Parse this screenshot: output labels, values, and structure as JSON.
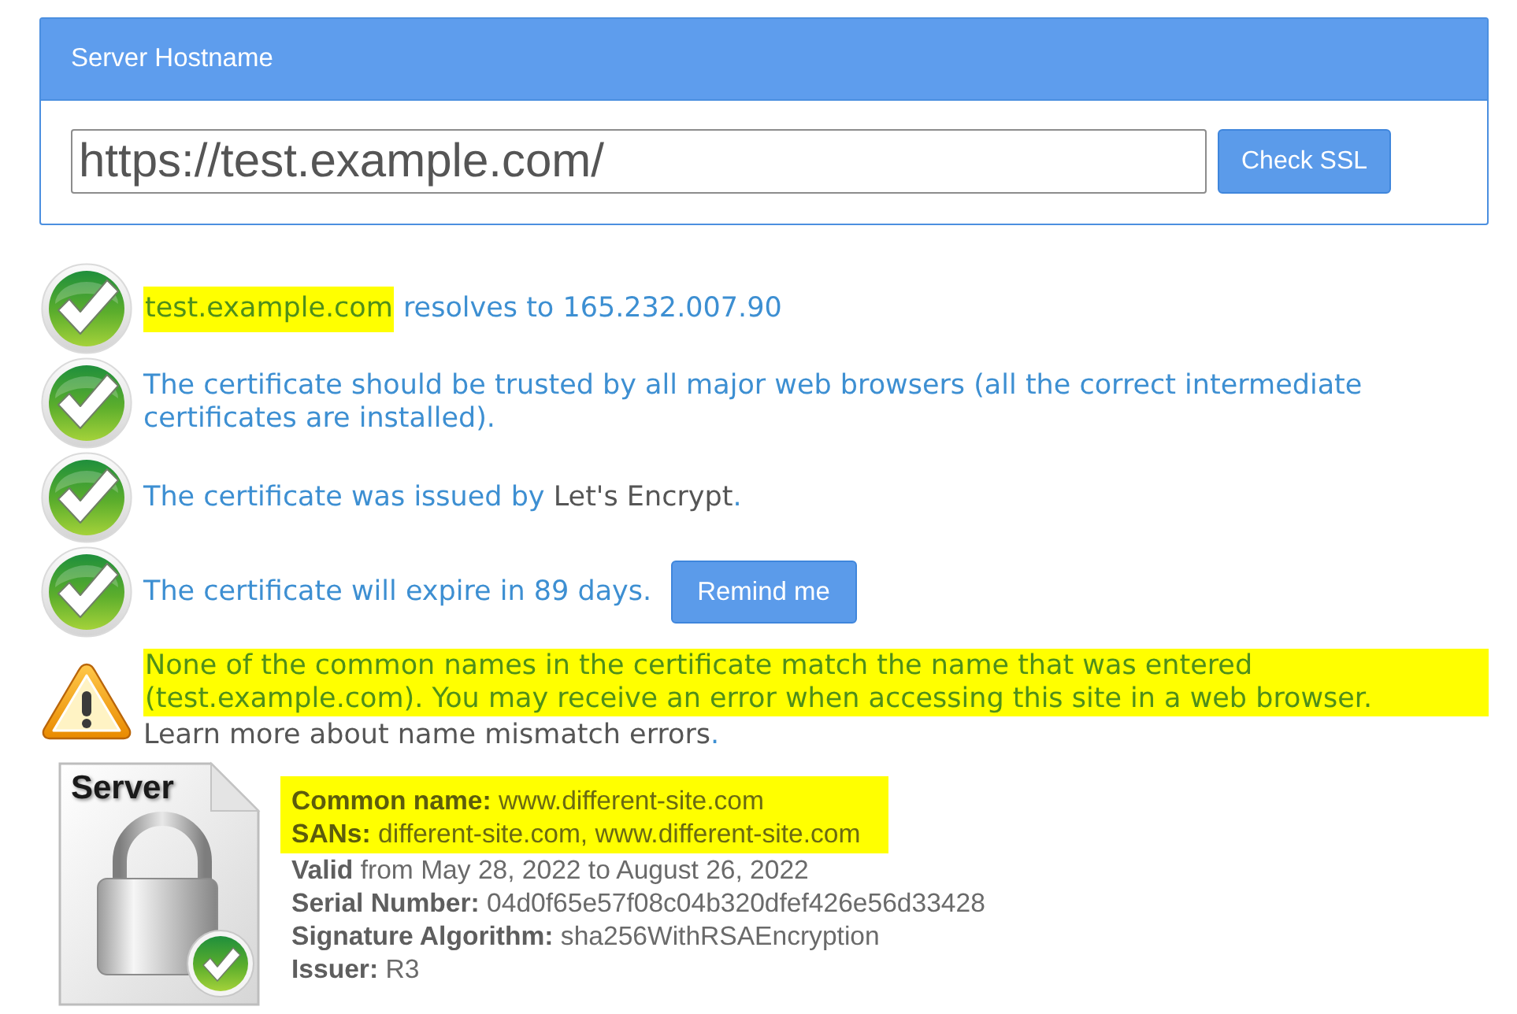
{
  "hostname_panel": {
    "title": "Server Hostname",
    "url": {
      "value": "https://test.example.com/"
    },
    "submit_button": "Check SSL"
  },
  "checks": [
    {
      "kind": "ok",
      "highlighted": false,
      "segments": [
        {
          "kind": "highlight",
          "text": "test.example.com"
        },
        {
          "kind": "plain",
          "text": " resolves to 165.232.007.90"
        }
      ]
    },
    {
      "kind": "ok",
      "highlighted": false,
      "segments": [
        {
          "kind": "plain",
          "text": "The certificate should be trusted by all major web browsers (all the correct intermediate certificates are installed)."
        }
      ]
    },
    {
      "kind": "ok",
      "highlighted": false,
      "segments": [
        {
          "kind": "plain",
          "text": "The certificate was issued by "
        },
        {
          "kind": "dark",
          "text": "Let's Encrypt"
        },
        {
          "kind": "plain",
          "text": "."
        }
      ]
    },
    {
      "kind": "ok",
      "highlighted": false,
      "segments": [
        {
          "kind": "plain",
          "text": "The certificate will expire in 89 days."
        }
      ],
      "button": "Remind me"
    },
    {
      "kind": "warning",
      "highlighted": true,
      "segments": [
        {
          "kind": "highlight",
          "text": "None of the common names in the certificate match the name that was entered (test.example.com). You may receive an error when accessing this site in a web browser."
        }
      ],
      "link": {
        "text": "Learn more about name mismatch errors",
        "suffix": "."
      }
    }
  ],
  "certificate": {
    "icon_label": "Server",
    "details": [
      {
        "text": "**Common name:** www.different-site.com",
        "highlighted": true
      },
      {
        "text": "**SANs:** different-site.com, www.different-site.com",
        "highlighted": true
      },
      {
        "text": "**Valid** from May 28, 2022 to August 26, 2022",
        "highlighted": false
      },
      {
        "text": "**Serial Number:** 04d0f65e57f08c04b320dfef426e56d33428",
        "highlighted": false
      },
      {
        "text": "**Signature Algorithm:** sha256WithRSAEncryption",
        "highlighted": false
      },
      {
        "text": "**Issuer:** R3",
        "highlighted": false
      }
    ]
  }
}
